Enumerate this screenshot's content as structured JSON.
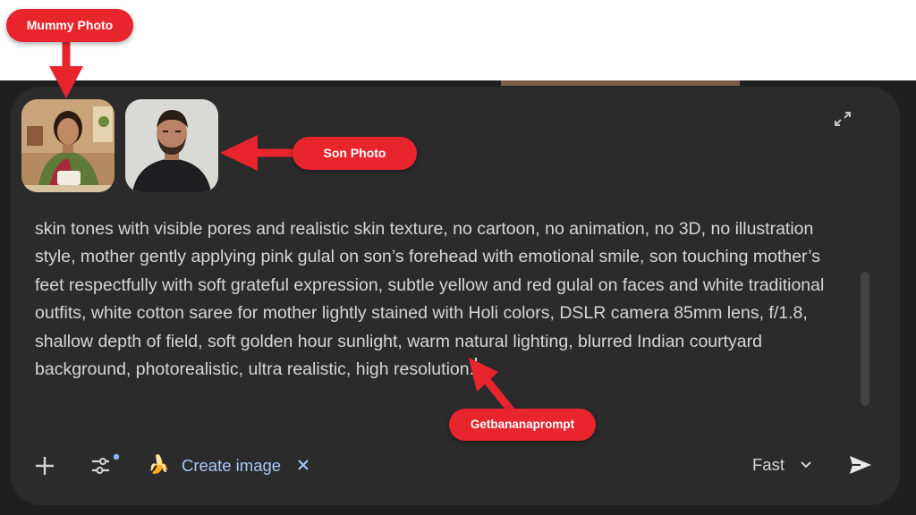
{
  "annotations": {
    "mummy_label": "Mummy Photo",
    "son_label": "Son Photo",
    "source_label": "Getbananaprompt",
    "color": "#e8242c"
  },
  "attachments": [
    {
      "name": "mummy-photo",
      "icon": "portrait-woman-saree"
    },
    {
      "name": "son-photo",
      "icon": "portrait-man-beard"
    }
  ],
  "composer": {
    "prompt_text": "skin tones with visible pores and realistic skin texture, no cartoon, no animation, no 3D, no illustration style, mother gently applying pink gulal on son’s forehead with emotional smile, son touching mother’s feet respectfully with soft grateful expression, subtle yellow and red gulal on faces and white traditional outfits, white cotton saree for mother lightly stained with Holi colors, DSLR camera 85mm lens, f/1.8, shallow depth of field, soft golden hour sunlight, warm natural lighting, blurred Indian courtyard background, photorealistic, ultra realistic, high resolution.",
    "expand_icon": "collapse-arrows-icon"
  },
  "toolbar": {
    "add_icon": "plus-icon",
    "tools_icon": "tools-sliders-icon",
    "chip_emoji": "🍌",
    "chip_label": "Create image",
    "chip_close_icon": "close-icon",
    "model_label": "Fast",
    "model_icon": "chevron-down-icon",
    "send_icon": "send-icon"
  },
  "colors": {
    "composer_bg": "#2b2b2c",
    "text": "#d6d6d6",
    "chip_accent": "#a8c7fa",
    "indicator_dot": "#8ab4f8"
  }
}
